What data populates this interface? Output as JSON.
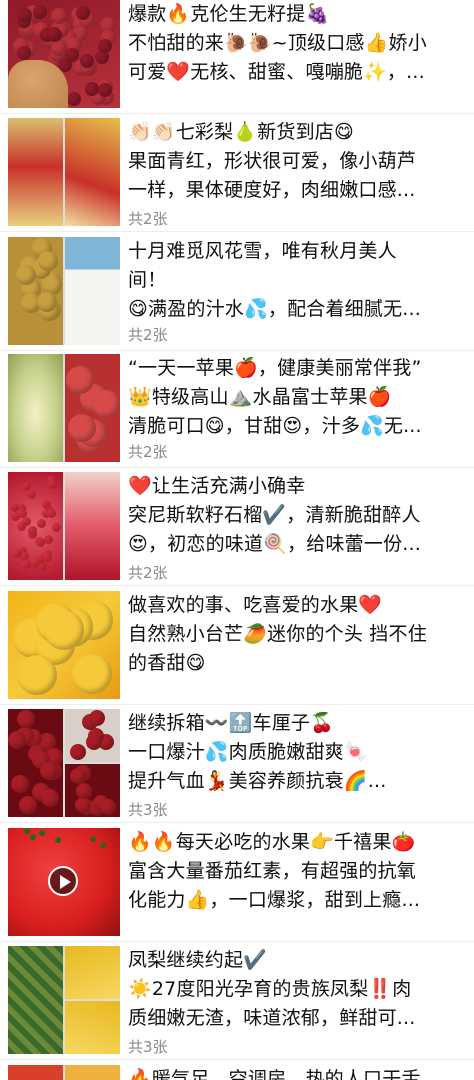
{
  "posts": [
    {
      "lines": [
        "爆款🔥克伦生无籽提🍇",
        "不怕甜的来🐌🐌~顶级口感👍娇小",
        "可爱❤️无核、甜蜜、嘎嘣脆✨，..."
      ],
      "count": "",
      "thumb_type": "grape",
      "colors": [
        "#8e1a2a",
        "#b8323c",
        "#d9a36b"
      ]
    },
    {
      "lines": [
        "👏🏻👏🏻七彩梨🍐新货到店😋",
        "果面青红，形状很可爱，像小葫芦",
        "一样，果体硬度好，肉细嫩口感..."
      ],
      "count": "共2张",
      "thumb_type": "pear",
      "colors": [
        "#c8302a",
        "#e6c04a",
        "#f0e6c8"
      ]
    },
    {
      "lines": [
        "十月难觅风花雪，唯有秋月美人",
        "间！",
        "😋满盈的汁水💦，配合着细腻无..."
      ],
      "count": "共2张",
      "thumb_type": "snow",
      "colors": [
        "#b8903a",
        "#7fb6d8",
        "#f4f4f0"
      ]
    },
    {
      "lines": [
        "“一天一苹果🍎，健康美丽常伴我”",
        "👑特级高山⛰️水晶富士苹果🍎",
        "清脆可口😋，甘甜😍，汁多💦无..."
      ],
      "count": "共2张",
      "thumb_type": "apple",
      "colors": [
        "#c4d08a",
        "#d64a4a",
        "#b83030"
      ]
    },
    {
      "lines": [
        "❤️让生活充满小确幸",
        "突尼斯软籽石榴✔️，清新脆甜醉人",
        "😍，初恋的味道🍭，给味蕾一份..."
      ],
      "count": "共2张",
      "thumb_type": "pomegranate",
      "colors": [
        "#b0142a",
        "#e25a6a",
        "#f2d0c8"
      ]
    },
    {
      "lines": [
        "做喜欢的事、吃喜爱的水果❤️",
        "自然熟小台芒🥭迷你的个头 挡不住",
        "的香甜😋"
      ],
      "count": "",
      "thumb_type": "mango",
      "colors": [
        "#f2b418",
        "#f6c93a",
        "#e89a10"
      ]
    },
    {
      "lines": [
        "继续拆箱〰️🔝车厘子🍒",
        "一口爆汁💦肉质脆嫩甜爽🍬",
        "提升气血💃美容养颜抗衰🌈..."
      ],
      "count": "共3张",
      "thumb_type": "cherry",
      "colors": [
        "#6a0a12",
        "#a81e26",
        "#d8d0c8"
      ]
    },
    {
      "lines": [
        "🔥🔥每天必吃的水果👉千禧果🍅",
        "富含大量番茄红素，有超强的抗氧",
        "化能力👍，一口爆浆，甜到上瘾..."
      ],
      "count": "",
      "thumb_type": "tomato",
      "colors": [
        "#d81e1e",
        "#f04040",
        "#3a7a2a"
      ]
    },
    {
      "lines": [
        "凤梨继续约起✔️",
        "☀️27度阳光孕育的贵族凤梨‼️肉",
        "质细嫩无渣，味道浓郁，鲜甜可..."
      ],
      "count": "共3张",
      "thumb_type": "pineapple",
      "colors": [
        "#3a6a2a",
        "#e8b820",
        "#f6d860"
      ]
    },
    {
      "lines": [
        "🔥暖气足，空调房，热的人口干舌"
      ],
      "count": "",
      "thumb_type": "partial",
      "colors": [
        "#d8402a",
        "#f0b040",
        "#ffffff"
      ]
    }
  ]
}
